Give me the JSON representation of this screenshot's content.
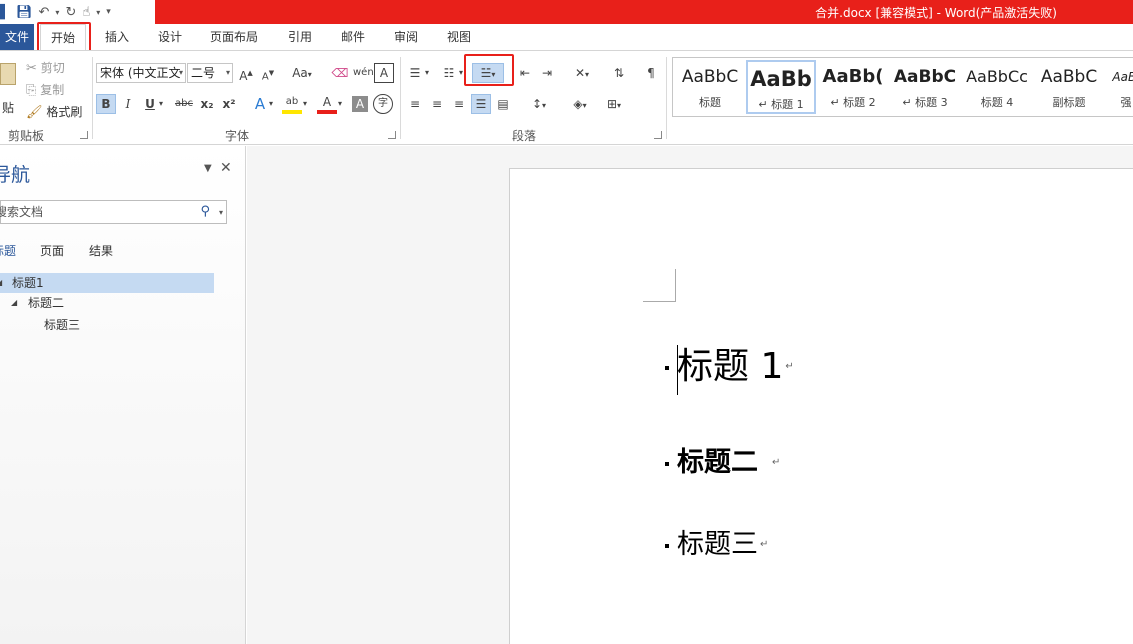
{
  "window": {
    "title": "合并.docx [兼容模式] -  Word(产品激活失败)"
  },
  "tabs": [
    {
      "label": "文件"
    },
    {
      "label": "开始"
    },
    {
      "label": "插入"
    },
    {
      "label": "设计"
    },
    {
      "label": "页面布局"
    },
    {
      "label": "引用"
    },
    {
      "label": "邮件"
    },
    {
      "label": "审阅"
    },
    {
      "label": "视图"
    }
  ],
  "clipboard": {
    "paste": "贴",
    "cut": "剪切",
    "copy": "复制",
    "format_painter": "格式刷",
    "label": "剪贴板"
  },
  "font": {
    "name": "宋体 (中文正文",
    "size": "二号",
    "label": "字体",
    "case": "Aa",
    "phonetic": "wén",
    "char_border": "A",
    "bold": "B",
    "italic": "I",
    "underline": "U",
    "strike": "abc",
    "sub": "x₂",
    "sup": "x²",
    "effects": "A",
    "highlight": "ab",
    "color": "A",
    "shading": "A",
    "enclose": "字",
    "grow": "A",
    "shrink": "A"
  },
  "paragraph": {
    "label": "段落"
  },
  "styles": [
    {
      "sample": "AaBbC",
      "name": "标题"
    },
    {
      "sample": "AaBb",
      "name": "↵ 标题 1"
    },
    {
      "sample": "AaBb(",
      "name": "↵ 标题 2"
    },
    {
      "sample": "AaBbC",
      "name": "↵ 标题 3"
    },
    {
      "sample": "AaBbCc",
      "name": "标题 4"
    },
    {
      "sample": "AaBbC",
      "name": "副标题"
    },
    {
      "sample": "AaBl",
      "name": "强"
    }
  ],
  "nav": {
    "title": "导航",
    "search_placeholder": "搜索文档",
    "tabs": [
      "标题",
      "页面",
      "结果"
    ],
    "tree": [
      {
        "label": "标题1",
        "level": 1
      },
      {
        "label": "标题二",
        "level": 2
      },
      {
        "label": "标题三",
        "level": 3
      }
    ]
  },
  "document": {
    "paragraphs": [
      {
        "text": "标题 1",
        "mark": "↵"
      },
      {
        "text": "标题二",
        "mark": "↵"
      },
      {
        "text": "标题三",
        "mark": "↵"
      }
    ]
  },
  "colors": {
    "accent": "#2b579a",
    "titlebar": "#e8201a",
    "highlight_box": "#e8201a",
    "selection": "#c5daf2"
  }
}
